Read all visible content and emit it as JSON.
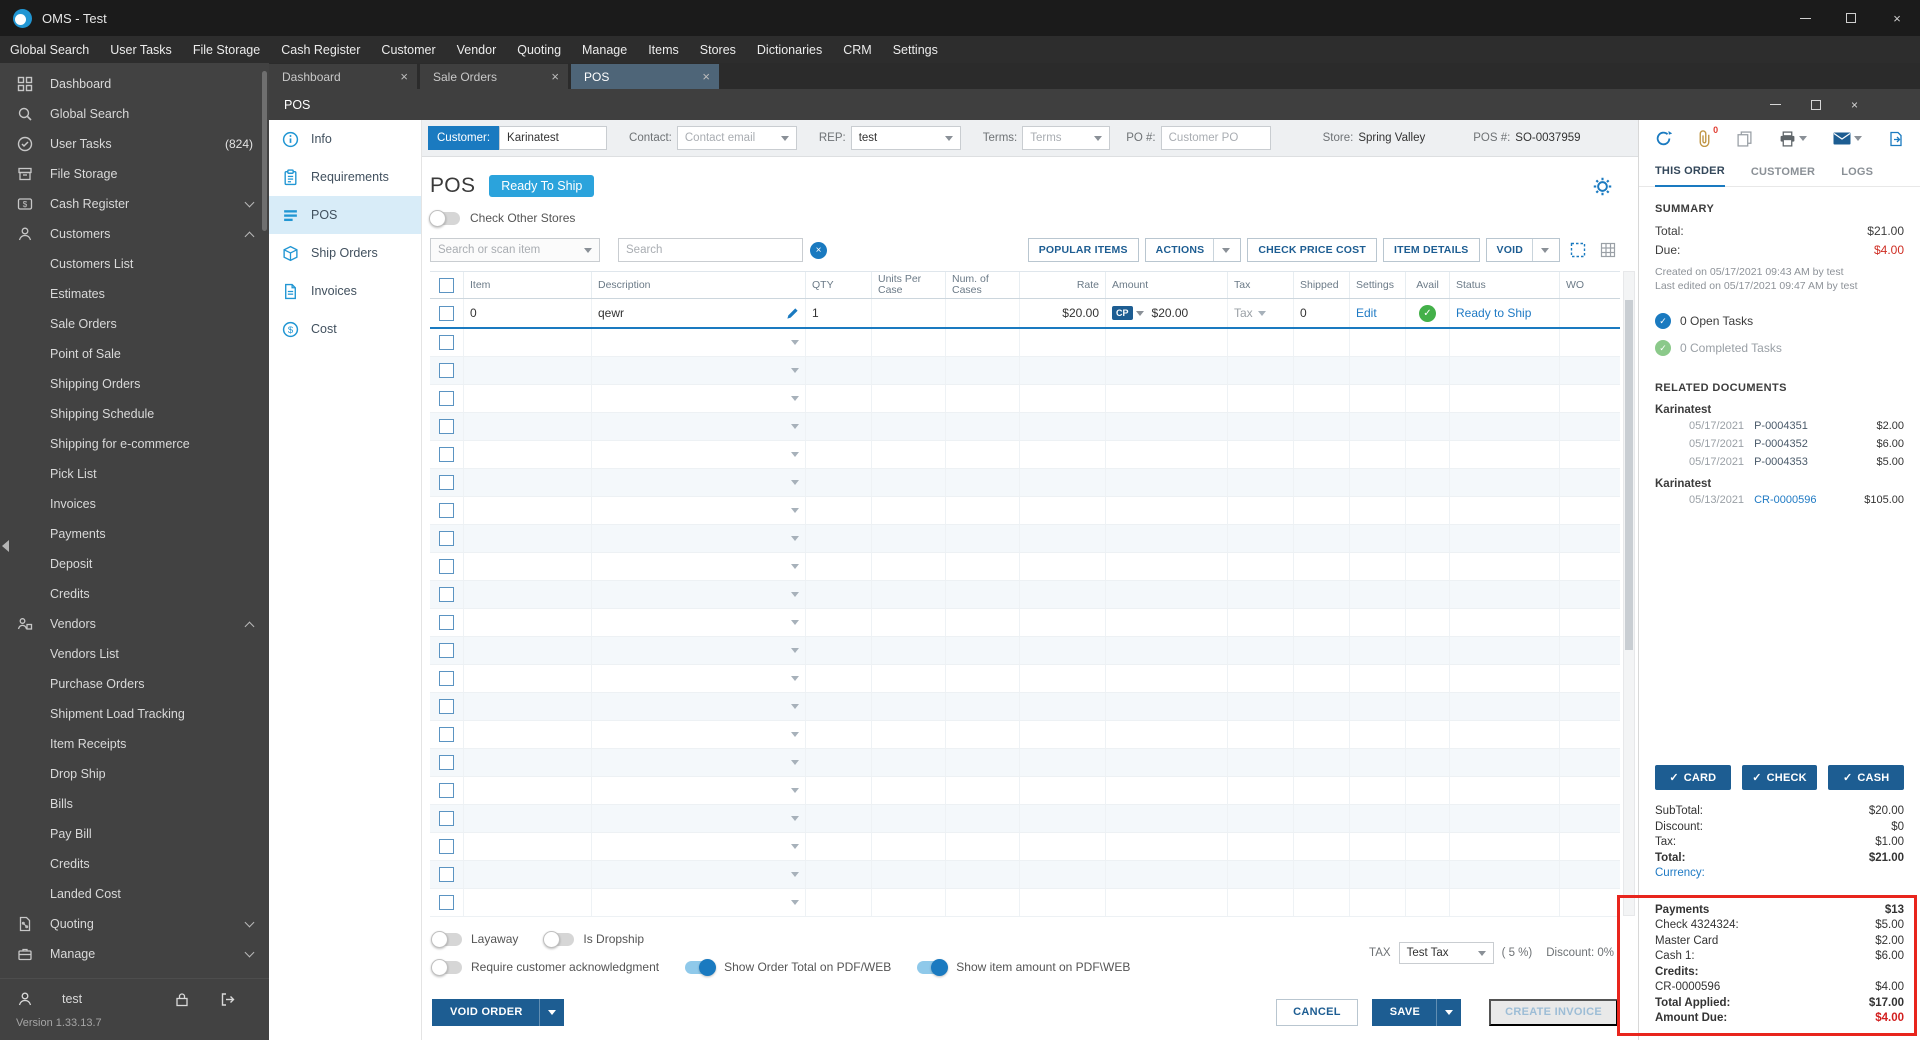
{
  "app": {
    "title": "OMS - Test",
    "user": "test",
    "version": "Version 1.33.13.7"
  },
  "menu": [
    "Global Search",
    "User Tasks",
    "File Storage",
    "Cash Register",
    "Customer",
    "Vendor",
    "Quoting",
    "Manage",
    "Items",
    "Stores",
    "Dictionaries",
    "CRM",
    "Settings"
  ],
  "mdi_tabs": [
    {
      "label": "Dashboard",
      "active": false
    },
    {
      "label": "Sale Orders",
      "active": false
    },
    {
      "label": "POS",
      "active": true
    }
  ],
  "sidebar": {
    "items": [
      {
        "label": "Dashboard",
        "icon": "dashboard"
      },
      {
        "label": "Global Search",
        "icon": "search"
      },
      {
        "label": "User Tasks",
        "icon": "tasks",
        "badge": "(824)"
      },
      {
        "label": "File Storage",
        "icon": "storage"
      },
      {
        "label": "Cash Register",
        "icon": "cash",
        "chevron": "down"
      },
      {
        "label": "Customers",
        "icon": "customers",
        "chevron": "up"
      },
      {
        "label": "Customers List",
        "child": true
      },
      {
        "label": "Estimates",
        "child": true
      },
      {
        "label": "Sale Orders",
        "child": true
      },
      {
        "label": "Point of Sale",
        "child": true
      },
      {
        "label": "Shipping Orders",
        "child": true
      },
      {
        "label": "Shipping Schedule",
        "child": true
      },
      {
        "label": "Shipping for e-commerce",
        "child": true
      },
      {
        "label": "Pick List",
        "child": true
      },
      {
        "label": "Invoices",
        "child": true
      },
      {
        "label": "Payments",
        "child": true
      },
      {
        "label": "Deposit",
        "child": true
      },
      {
        "label": "Credits",
        "child": true
      },
      {
        "label": "Vendors",
        "icon": "vendors",
        "chevron": "up"
      },
      {
        "label": "Vendors List",
        "child": true
      },
      {
        "label": "Purchase Orders",
        "child": true
      },
      {
        "label": "Shipment Load Tracking",
        "child": true
      },
      {
        "label": "Item Receipts",
        "child": true
      },
      {
        "label": "Drop Ship",
        "child": true
      },
      {
        "label": "Bills",
        "child": true
      },
      {
        "label": "Pay Bill",
        "child": true
      },
      {
        "label": "Credits",
        "child": true
      },
      {
        "label": "Landed Cost",
        "child": true
      },
      {
        "label": "Quoting",
        "icon": "quoting",
        "chevron": "down"
      },
      {
        "label": "Manage",
        "icon": "manage",
        "chevron": "down"
      }
    ]
  },
  "pos": {
    "window_title": "POS",
    "nav": [
      {
        "label": "Info",
        "icon": "info"
      },
      {
        "label": "Requirements",
        "icon": "requirements"
      },
      {
        "label": "POS",
        "icon": "pos",
        "active": true
      },
      {
        "label": "Ship Orders",
        "icon": "ship"
      },
      {
        "label": "Invoices",
        "icon": "invoice"
      },
      {
        "label": "Cost",
        "icon": "cost"
      }
    ],
    "header": {
      "customer_label": "Customer:",
      "customer": "Karinatest",
      "contact_label": "Contact:",
      "contact_placeholder": "Contact email",
      "rep_label": "REP:",
      "rep": "test",
      "terms_label": "Terms:",
      "terms_placeholder": "Terms",
      "po_label": "PO #:",
      "po_placeholder": "Customer PO",
      "store_label": "Store:",
      "store": "Spring Valley",
      "pos_label": "POS #:",
      "pos_number": "SO-0037959"
    },
    "title": "POS",
    "status_badge": "Ready To Ship",
    "check_other_stores_label": "Check Other Stores",
    "search_select_placeholder": "Search or scan item",
    "search_placeholder": "Search",
    "actions_bar": {
      "popular_items": "POPULAR ITEMS",
      "actions": "ACTIONS",
      "check_price_cost": "CHECK PRICE COST",
      "item_details": "ITEM DETAILS",
      "void": "VOID"
    },
    "table": {
      "columns": [
        "Item",
        "Description",
        "QTY",
        "Units Per Case",
        "Num. of Cases",
        "Rate",
        "Amount",
        "Tax",
        "Shipped",
        "Settings",
        "Avail",
        "Status",
        "WO"
      ],
      "row": {
        "item": "0",
        "description": "qewr",
        "qty": "1",
        "rate": "$20.00",
        "price_badge": "CP",
        "amount": "$20.00",
        "tax": "Tax",
        "shipped": "0",
        "settings": "Edit",
        "status": "Ready to Ship"
      },
      "empty_rows": 21
    },
    "footer": {
      "toggles_row1": [
        {
          "label": "Layaway",
          "on": false
        },
        {
          "label": "Is Dropship",
          "on": false
        }
      ],
      "toggles_row2": [
        {
          "label": "Require customer acknowledgment",
          "on": false
        },
        {
          "label": "Show Order Total on PDF/WEB",
          "on": true
        },
        {
          "label": "Show item amount on PDF\\WEB",
          "on": true
        }
      ],
      "tax_label": "TAX",
      "tax_value": "Test Tax",
      "tax_rate": "( 5 %)",
      "discount_label": "Discount:",
      "discount_value": "0%",
      "void_order": "VOID ORDER",
      "cancel": "CANCEL",
      "save": "SAVE",
      "create_invoice": "CREATE INVOICE"
    }
  },
  "panel": {
    "toolbar": {
      "attachment_count": "0"
    },
    "tabs": [
      {
        "label": "THIS ORDER",
        "active": true
      },
      {
        "label": "CUSTOMER",
        "active": false
      },
      {
        "label": "LOGS",
        "active": false
      }
    ],
    "summary": {
      "heading": "SUMMARY",
      "rows": [
        {
          "label": "Total:",
          "value": "$21.00"
        },
        {
          "label": "Due:",
          "value": "$4.00"
        }
      ],
      "created": "Created on 05/17/2021 09:43 AM by test",
      "edited": "Last edited on 05/17/2021 09:47 AM by test"
    },
    "tasks": {
      "open": "0 Open Tasks",
      "completed": "0 Completed Tasks"
    },
    "related": {
      "heading": "RELATED DOCUMENTS",
      "groups": [
        {
          "customer": "Karinatest",
          "docs": [
            {
              "date": "05/17/2021",
              "number": "P-0004351",
              "amount": "$2.00"
            },
            {
              "date": "05/17/2021",
              "number": "P-0004352",
              "amount": "$6.00"
            },
            {
              "date": "05/17/2021",
              "number": "P-0004353",
              "amount": "$5.00"
            }
          ]
        },
        {
          "customer": "Karinatest",
          "docs": [
            {
              "date": "05/13/2021",
              "number": "CR-0000596",
              "amount": "$105.00",
              "link": true
            }
          ]
        }
      ]
    },
    "pay_buttons": [
      "CARD",
      "CHECK",
      "CASH"
    ],
    "totals": [
      {
        "label": "SubTotal:",
        "value": "$20.00"
      },
      {
        "label": "Discount:",
        "value": "$0"
      },
      {
        "label": "Tax:",
        "value": "$1.00"
      },
      {
        "label": "Total:",
        "value": "$21.00",
        "bold": true
      },
      {
        "label": "Currency:",
        "value": "",
        "link": true
      }
    ],
    "payments": [
      {
        "label": "Payments",
        "value": "$13",
        "bold": true
      },
      {
        "label": "Check 4324324:",
        "value": "$5.00"
      },
      {
        "label": "Master Card",
        "value": "$2.00"
      },
      {
        "label": "Cash 1:",
        "value": "$6.00"
      },
      {
        "label": "Credits:",
        "value": "",
        "bold": true
      },
      {
        "label": "CR-0000596",
        "value": "$4.00"
      },
      {
        "label": "Total Applied:",
        "value": "$17.00",
        "bold": true
      },
      {
        "label": "Amount Due:",
        "value": "$4.00",
        "bold": true,
        "red": true
      }
    ]
  },
  "colors": {
    "accent": "#1a7ac0",
    "badge_blue": "#2ba3dc",
    "button_blue": "#1d5d92",
    "annotation_red": "#e8251d",
    "due_red": "#d21f1f",
    "success_green": "#43b049"
  }
}
